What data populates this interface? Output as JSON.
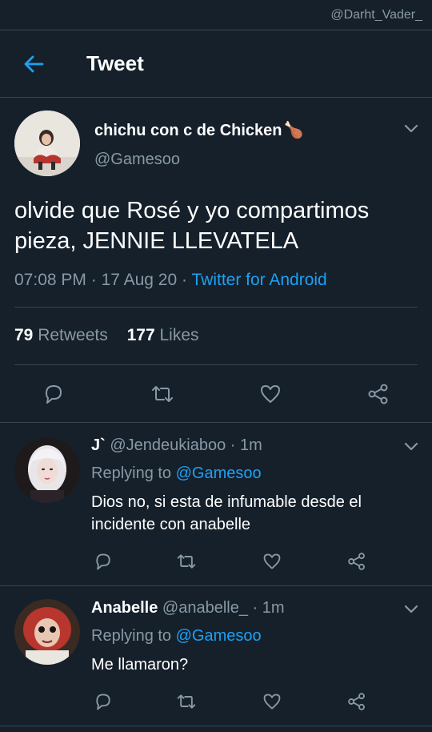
{
  "watermark": "@Darht_Vader_",
  "header": {
    "title": "Tweet"
  },
  "tweet": {
    "author_name": "chichu con c de Chicken",
    "author_emoji": "🍗",
    "author_handle": "@Gamesoo",
    "text": "olvide que Rosé y yo compartimos pieza, JENNIE LLEVATELA",
    "time": "07:08 PM",
    "date": "17 Aug 20",
    "separator": "·",
    "client": "Twitter for Android",
    "retweets_count": "79",
    "retweets_label": "Retweets",
    "likes_count": "177",
    "likes_label": "Likes"
  },
  "replies": [
    {
      "name": "J`",
      "handle": "@Jendeukiaboo",
      "time": "· 1m",
      "replying_label": "Replying to",
      "replying_to": "@Gamesoo",
      "text": "Dios no, si esta de infumable desde el incidente con anabelle"
    },
    {
      "name": "Anabelle",
      "handle": "@anabelle_",
      "time": "· 1m",
      "replying_label": "Replying to",
      "replying_to": "@Gamesoo",
      "text": "Me llamaron?"
    }
  ],
  "icons": {
    "back": "arrow-left-icon",
    "more": "chevron-down-icon",
    "reply": "speech-bubble-icon",
    "retweet": "retweet-icon",
    "like": "heart-icon",
    "share": "share-icon"
  },
  "colors": {
    "background": "#15202b",
    "accent": "#1da1f2",
    "secondary_text": "#8899a6",
    "divider": "#38444d"
  }
}
